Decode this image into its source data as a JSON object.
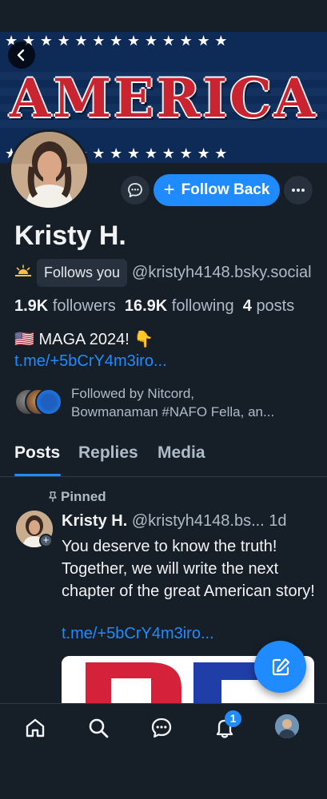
{
  "banner": {
    "word": "AMERICA"
  },
  "profile": {
    "display_name": "Kristy H.",
    "follows_you": "Follows you",
    "handle": "@kristyh4148.bsky.social",
    "stats": {
      "followers_count": "1.9K",
      "followers_label": "followers",
      "following_count": "16.9K",
      "following_label": "following",
      "posts_count": "4",
      "posts_label": "posts"
    },
    "bio_line": "🇺🇸 MAGA 2024! 👇",
    "bio_link": "t.me/+5bCrY4m3iro...",
    "followed_by_line1": "Followed by Nitcord,",
    "followed_by_line2": "Bowmanaman #NAFO Fella, an..."
  },
  "actions": {
    "follow_back_label": "Follow Back",
    "follow_back_plus": "+"
  },
  "tabs": [
    {
      "label": "Posts",
      "active": true
    },
    {
      "label": "Replies",
      "active": false
    },
    {
      "label": "Media",
      "active": false
    }
  ],
  "post": {
    "pinned_label": "Pinned",
    "author_name": "Kristy H.",
    "author_handle": "@kristyh4148.bs...",
    "time": "1d",
    "text": "You deserve to know the truth! Together, we will write the next chapter of the great American story!",
    "link": "t.me/+5bCrY4m3iro..."
  },
  "nav": {
    "items": [
      "home-icon",
      "search-icon",
      "chat-icon",
      "bell-icon",
      "profile-avatar"
    ],
    "notification_count": "1"
  },
  "colors": {
    "background": "#161e27",
    "accent": "#208bfe",
    "muted_text": "#aebbc9",
    "chip_background": "#26313d"
  }
}
